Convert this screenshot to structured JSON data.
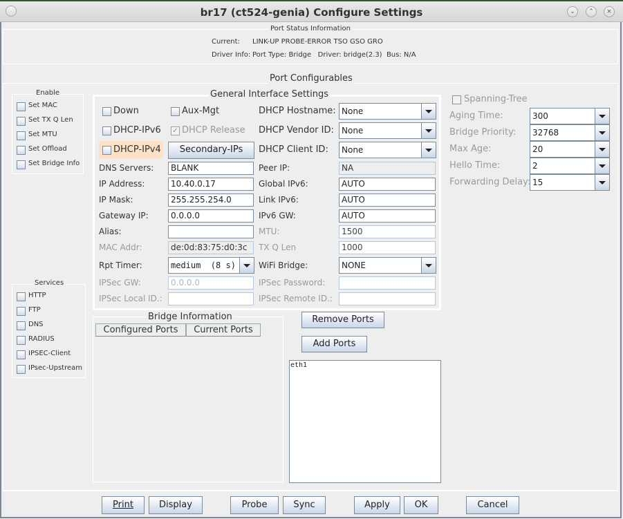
{
  "window": {
    "title": "br17  (ct524-genia) Configure Settings",
    "controls": [
      "minimize",
      "maximize",
      "close"
    ]
  },
  "status": {
    "legend": "Port Status Information",
    "current_label": "Current:",
    "current_value": "LINK-UP PROBE-ERROR TSO GSO GRO",
    "driver_label": "Driver Info:",
    "driver_value": "Port Type: Bridge   Driver: bridge(2.3)  Bus: N/A"
  },
  "configurables_legend": "Port Configurables",
  "enable": {
    "legend": "Enable",
    "items": [
      {
        "label": "Set MAC",
        "checked": false
      },
      {
        "label": "Set TX Q Len",
        "checked": false
      },
      {
        "label": "Set MTU",
        "checked": false
      },
      {
        "label": "Set Offload",
        "checked": false
      },
      {
        "label": "Set Bridge Info",
        "checked": false
      }
    ]
  },
  "services": {
    "legend": "Services",
    "items": [
      {
        "label": "HTTP",
        "checked": false
      },
      {
        "label": "FTP",
        "checked": false
      },
      {
        "label": "DNS",
        "checked": false
      },
      {
        "label": "RADIUS",
        "checked": false
      },
      {
        "label": "IPSEC-Client",
        "checked": false
      },
      {
        "label": "IPsec-Upstream",
        "checked": false
      }
    ]
  },
  "general": {
    "legend": "General Interface Settings",
    "down": "Down",
    "aux_mgt": "Aux-Mgt",
    "dhcp_ipv6": "DHCP-IPv6",
    "dhcp_release": "DHCP Release",
    "dhcp_ipv4": "DHCP-IPv4",
    "secondary_ips": "Secondary-IPs",
    "dns_servers_label": "DNS Servers:",
    "dns_servers": "BLANK",
    "ip_address_label": "IP Address:",
    "ip_address": "10.40.0.17",
    "ip_mask_label": "IP Mask:",
    "ip_mask": "255.255.254.0",
    "gateway_ip_label": "Gateway IP:",
    "gateway_ip": "0.0.0.0",
    "alias_label": "Alias:",
    "alias": "",
    "mac_addr_label": "MAC Addr:",
    "mac_addr": "de:0d:83:75:d0:3c",
    "rpt_timer_label": "Rpt Timer:",
    "rpt_timer": "medium  (8 s)",
    "ipsec_gw_label": "IPSec GW:",
    "ipsec_gw": "0.0.0.0",
    "ipsec_local_id_label": "IPSec Local ID.:",
    "ipsec_local_id": "",
    "dhcp_hostname_label": "DHCP Hostname:",
    "dhcp_hostname": "None",
    "dhcp_vendor_id_label": "DHCP Vendor ID:",
    "dhcp_vendor_id": "None",
    "dhcp_client_id_label": "DHCP Client ID:",
    "dhcp_client_id": "None",
    "peer_ip_label": "Peer IP:",
    "peer_ip": "NA",
    "global_ipv6_label": "Global IPv6:",
    "global_ipv6": "AUTO",
    "link_ipv6_label": "Link IPv6:",
    "link_ipv6": "AUTO",
    "ipv6_gw_label": "IPv6 GW:",
    "ipv6_gw": "AUTO",
    "mtu_label": "MTU:",
    "mtu": "1500",
    "txqlen_label": "TX Q Len",
    "txqlen": "1000",
    "wifi_bridge_label": "WiFi Bridge:",
    "wifi_bridge": "NONE",
    "ipsec_password_label": "IPSec Password:",
    "ipsec_password": "",
    "ipsec_remote_id_label": "IPSec Remote ID.:",
    "ipsec_remote_id": ""
  },
  "stp": {
    "spanning_tree": "Spanning-Tree",
    "aging_time_label": "Aging Time:",
    "aging_time": "300",
    "bridge_priority_label": "Bridge Priority:",
    "bridge_priority": "32768",
    "max_age_label": "Max Age:",
    "max_age": "20",
    "hello_time_label": "Hello Time:",
    "hello_time": "2",
    "forwarding_delay_label": "Forwarding Delay:",
    "forwarding_delay": "15"
  },
  "bridge": {
    "legend": "Bridge Information",
    "configured_ports": "Configured Ports",
    "current_ports": "Current Ports",
    "remove_ports": "Remove Ports",
    "add_ports": "Add Ports",
    "port_list": "eth1"
  },
  "footer": {
    "print": "Print",
    "display": "Display",
    "probe": "Probe",
    "sync": "Sync",
    "apply": "Apply",
    "ok": "OK",
    "cancel": "Cancel"
  }
}
